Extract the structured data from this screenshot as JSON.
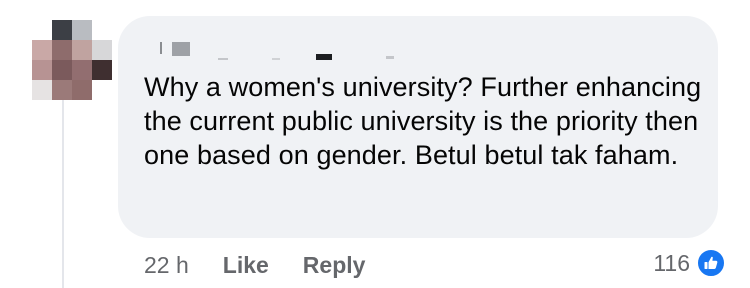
{
  "comment": {
    "text": "Why a women's university? Further enhancing the current public university is the priority then one based on gender. Betul betul tak faham.",
    "author_name": "",
    "avatar_blurred": true
  },
  "actions": {
    "timestamp": "22 h",
    "like_label": "Like",
    "reply_label": "Reply"
  },
  "reactions": {
    "count": "116",
    "icon": "thumbs-up-icon",
    "badge_color": "#1877f2"
  },
  "colors": {
    "bubble": "#f0f2f5",
    "text": "#050505",
    "meta": "#65676b"
  }
}
